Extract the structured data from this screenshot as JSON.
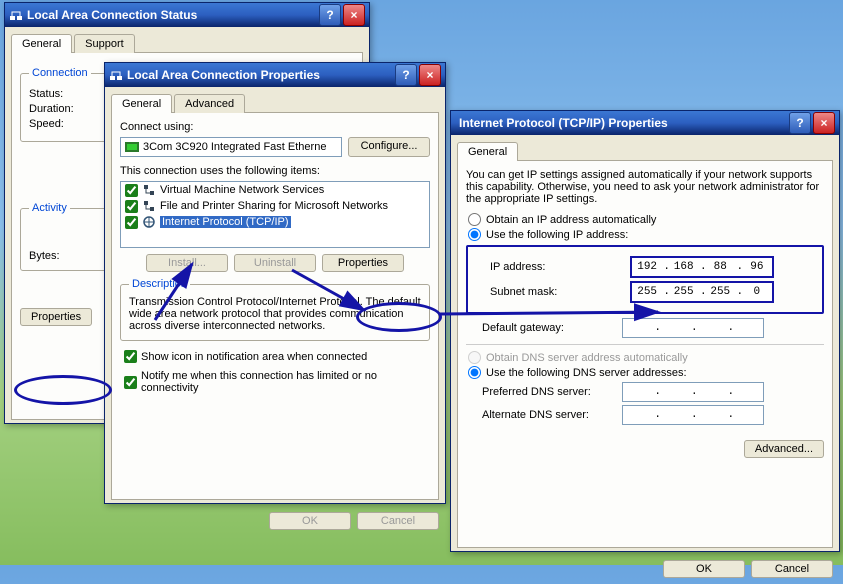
{
  "status_window": {
    "title": "Local Area Connection Status",
    "tabs": [
      "General",
      "Support"
    ],
    "groups": {
      "connection": "Connection",
      "activity": "Activity"
    },
    "labels": {
      "status": "Status:",
      "duration": "Duration:",
      "speed": "Speed:",
      "bytes": "Bytes:"
    },
    "properties_btn": "Properties"
  },
  "props_window": {
    "title": "Local Area Connection Properties",
    "tabs": [
      "General",
      "Advanced"
    ],
    "connect_using_label": "Connect using:",
    "adapter": "3Com 3C920 Integrated Fast Etherne",
    "configure_btn": "Configure...",
    "items_label": "This connection uses the following items:",
    "items": [
      {
        "label": "Virtual Machine Network Services",
        "icon": "service"
      },
      {
        "label": "File and Printer Sharing for Microsoft Networks",
        "icon": "service"
      },
      {
        "label": "Internet Protocol (TCP/IP)",
        "icon": "protocol"
      }
    ],
    "buttons": {
      "install": "Install...",
      "uninstall": "Uninstall",
      "properties": "Properties"
    },
    "desc_legend": "Description",
    "desc_text": "Transmission Control Protocol/Internet Protocol. The default wide area network protocol that provides communication across diverse interconnected networks.",
    "cb1": "Show icon in notification area when connected",
    "cb2": "Notify me when this connection has limited or no connectivity",
    "ok": "OK",
    "cancel": "Cancel"
  },
  "tcpip_window": {
    "title": "Internet Protocol (TCP/IP) Properties",
    "tab": "General",
    "intro": "You can get IP settings assigned automatically if your network supports this capability. Otherwise, you need to ask your network administrator for the appropriate IP settings.",
    "obtain_ip": "Obtain an IP address automatically",
    "use_ip": "Use the following IP address:",
    "ip_label": "IP address:",
    "subnet_label": "Subnet mask:",
    "gateway_label": "Default gateway:",
    "ip_value": [
      "192",
      "168",
      "88",
      "96"
    ],
    "subnet_value": [
      "255",
      "255",
      "255",
      "0"
    ],
    "gateway_value": [
      "",
      "",
      "",
      ""
    ],
    "obtain_dns": "Obtain DNS server address automatically",
    "use_dns": "Use the following DNS server addresses:",
    "pref_dns": "Preferred DNS server:",
    "alt_dns": "Alternate DNS server:",
    "advanced_btn": "Advanced...",
    "ok": "OK",
    "cancel": "Cancel"
  }
}
